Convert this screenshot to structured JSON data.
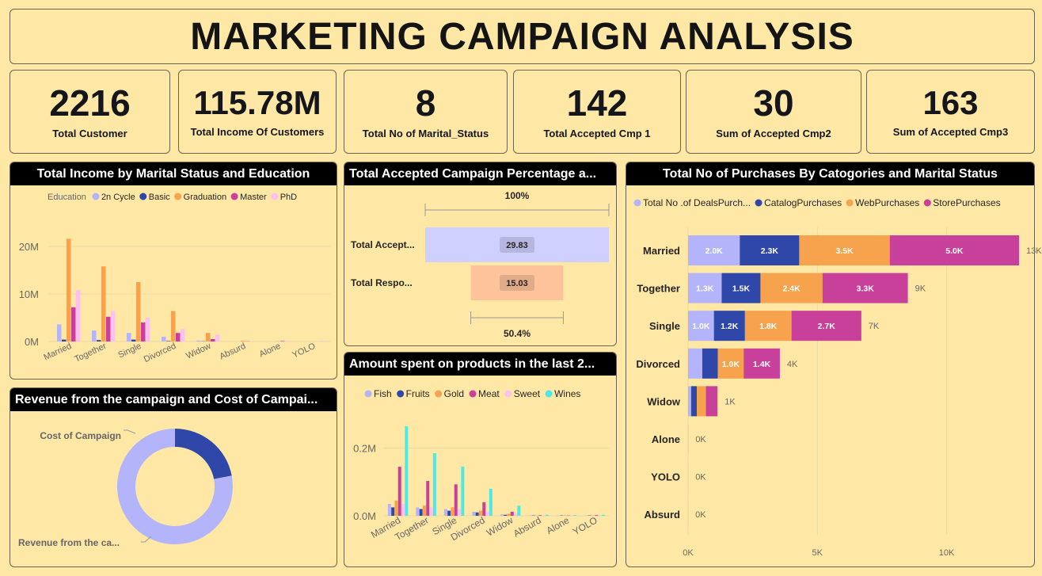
{
  "header": {
    "title": "MARKETING  CAMPAIGN ANALYSIS"
  },
  "kpis": [
    {
      "value": "2216",
      "label": "Total Customer"
    },
    {
      "value": "115.78M",
      "label": "Total Income Of Customers"
    },
    {
      "value": "8",
      "label": "Total No of Marital_Status"
    },
    {
      "value": "142",
      "label": "Total Accepted Cmp 1"
    },
    {
      "value": "30",
      "label": "Sum of Accepted Cmp2"
    },
    {
      "value": "163",
      "label": "Sum of Accepted Cmp3"
    }
  ],
  "colors": {
    "lavender": "#B4B4FA",
    "navy": "#2F47A8",
    "orange": "#F7A24D",
    "magenta": "#C8409A",
    "pink": "#FDC1F0",
    "cyan": "#4DE9E6",
    "lightLav": "#D0D0FF",
    "peach": "#FFC39C",
    "text": "#252423",
    "muted": "#666"
  },
  "chart_data": [
    {
      "id": "income",
      "type": "bar",
      "title": "Total Income by Marital Status and Education",
      "legend_title": "Education",
      "categories": [
        "Married",
        "Together",
        "Single",
        "Divorced",
        "Widow",
        "Absurd",
        "Alone",
        "YOLO"
      ],
      "series": [
        {
          "name": "2n Cycle",
          "values": [
            3.6,
            2.3,
            1.8,
            1.0,
            0.2,
            0,
            0,
            0
          ]
        },
        {
          "name": "Basic",
          "values": [
            0.4,
            0.3,
            0.4,
            0.1,
            0.05,
            0,
            0,
            0
          ]
        },
        {
          "name": "Graduation",
          "values": [
            21.6,
            15.8,
            12.5,
            6.4,
            1.8,
            0.15,
            0.05,
            0
          ]
        },
        {
          "name": "Master",
          "values": [
            7.2,
            5.2,
            4.0,
            1.8,
            0.5,
            0.05,
            0.1,
            0
          ]
        },
        {
          "name": "PhD",
          "values": [
            10.8,
            6.4,
            5.0,
            2.6,
            1.4,
            0,
            0.1,
            0.15
          ]
        }
      ],
      "yticks": [
        "0M",
        "10M",
        "20M"
      ],
      "ylim": [
        0,
        24
      ]
    },
    {
      "id": "funnel",
      "type": "bar",
      "title": "Total Accepted Campaign Percentage a...",
      "categories": [
        "Total Accept...",
        "Total Respo..."
      ],
      "values": [
        29.83,
        15.03
      ],
      "value_labels": [
        "29.83",
        "15.03"
      ],
      "top_percent": "100%",
      "bottom_percent": "50.4%"
    },
    {
      "id": "donut",
      "type": "pie",
      "title": "Revenue from the campaign and Cost of Campai...",
      "slices": [
        {
          "name": "Cost of Campaign",
          "value": 22
        },
        {
          "name": "Revenue from the ca...",
          "value": 78
        }
      ]
    },
    {
      "id": "products",
      "type": "bar",
      "title": "Amount spent on  products in the last 2...",
      "categories": [
        "Married",
        "Together",
        "Single",
        "Divorced",
        "Widow",
        "Absurd",
        "Alone",
        "YOLO"
      ],
      "series": [
        {
          "name": "Fish",
          "values": [
            0.035,
            0.025,
            0.02,
            0.012,
            0.004,
            0.001,
            0.001,
            0.001
          ]
        },
        {
          "name": "Fruits",
          "values": [
            0.025,
            0.02,
            0.015,
            0.01,
            0.003,
            0.001,
            0.001,
            0.001
          ]
        },
        {
          "name": "Gold",
          "values": [
            0.045,
            0.03,
            0.025,
            0.015,
            0.006,
            0.001,
            0.001,
            0.001
          ]
        },
        {
          "name": "Meat",
          "values": [
            0.145,
            0.103,
            0.093,
            0.04,
            0.012,
            0.002,
            0.001,
            0.002
          ]
        },
        {
          "name": "Sweet",
          "values": [
            0.035,
            0.025,
            0.02,
            0.012,
            0.005,
            0.001,
            0.001,
            0.001
          ]
        },
        {
          "name": "Wines",
          "values": [
            0.265,
            0.185,
            0.145,
            0.08,
            0.03,
            0.003,
            0.002,
            0.003
          ]
        }
      ],
      "yticks": [
        "0.0M",
        "0.2M"
      ],
      "ylim": [
        0,
        0.3
      ]
    },
    {
      "id": "purchases",
      "type": "bar",
      "title": "Total No of Purchases By Catogories and Marital Status",
      "categories": [
        "Married",
        "Together",
        "Single",
        "Divorced",
        "Widow",
        "Alone",
        "YOLO",
        "Absurd"
      ],
      "series": [
        {
          "name": "Total No .of DealsPurch...",
          "values": [
            2000,
            1300,
            1000,
            550,
            120,
            10,
            6,
            5
          ]
        },
        {
          "name": "CatalogPurchases",
          "values": [
            2300,
            1500,
            1200,
            600,
            220,
            0,
            0,
            0
          ]
        },
        {
          "name": "WebPurchases",
          "values": [
            3500,
            2400,
            1800,
            1000,
            350,
            0,
            0,
            0
          ]
        },
        {
          "name": "StorePurchases",
          "values": [
            5000,
            3300,
            2700,
            1400,
            450,
            0,
            0,
            0
          ]
        }
      ],
      "segment_labels": [
        [
          "2.0K",
          "2.3K",
          "3.5K",
          "5.0K"
        ],
        [
          "1.3K",
          "1.5K",
          "2.4K",
          "3.3K"
        ],
        [
          "1.0K",
          "1.2K",
          "1.8K",
          "2.7K"
        ],
        [
          "",
          "",
          "1.0K",
          "1.4K"
        ],
        [
          "",
          "",
          "",
          ""
        ],
        [
          "",
          "",
          "",
          ""
        ],
        [
          "",
          "",
          "",
          ""
        ],
        [
          "",
          "",
          "",
          ""
        ]
      ],
      "totals": [
        "13K",
        "9K",
        "7K",
        "4K",
        "1K",
        "0K",
        "0K",
        "0K"
      ],
      "xticks": [
        "0K",
        "5K",
        "10K"
      ],
      "xlim": [
        0,
        12800
      ]
    }
  ]
}
